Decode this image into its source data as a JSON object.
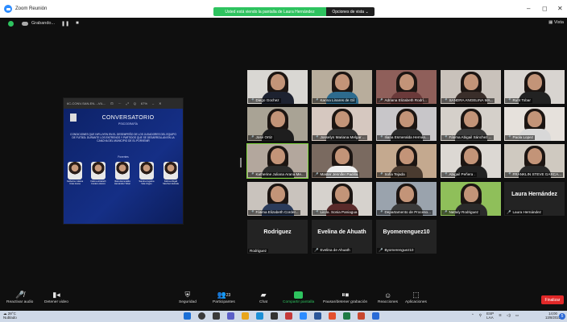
{
  "window": {
    "title": "Zoom Reunión",
    "minimize": "–",
    "maximize": "◻",
    "close": "✕"
  },
  "share_banner": {
    "text": "Usted está viendo la pantalla de Laura Hernández",
    "view_options": "Opciones de vista ⌄"
  },
  "topbar": {
    "recording_label": "Grabando...",
    "pause": "❚❚",
    "stop": "■",
    "view_label": "Vista"
  },
  "shared_screen": {
    "window_bar": [
      "6C-CONV-SAN-EN...-VIL...",
      "⊡",
      "···",
      "⤢",
      "Q",
      "67%",
      "–",
      "✕"
    ],
    "slide_title": "CONVERSATORIO",
    "slide_subtitle": "PSICOGRAFÍA",
    "slide_body": "CONDICIONES QUE INFLUYEN EN EL DESEMPEÑO DE LOS JUGADORES DEL EQUIPO DE FUTBOL DURANTE LOS ENTRENOS Y PARTIDOS QUE SE DESARROLLAN EN LA CANCHA DEL MUNICIPIO DE EL PORVENIR",
    "speakers_label": "Ponentes",
    "speakers": [
      "Katherine Juliana Urias Arana",
      "Fatima elizabeth Cordero Alonzo",
      "Iliana Esmeralda Hernández Tobar",
      "Sandra Angelina Vela Ungon",
      "Fátima Abigail Sánchez Estrada"
    ]
  },
  "participants": [
    {
      "name": "Diego Gochez",
      "video": true,
      "bg": "#d9d7d3",
      "shirt": "#1d2230"
    },
    {
      "name": "Karina Linares de Gil",
      "video": true,
      "bg": "#b8ad9c",
      "shirt": "#2d6b8e"
    },
    {
      "name": "Adriana Elizabeth Rodrí...",
      "video": true,
      "bg": "#8f5f5a",
      "shirt": "#6b3a3a"
    },
    {
      "name": "SANDRA ANGELINA MA...",
      "video": true,
      "bg": "#c9c2bb",
      "shirt": "#3a2e2a"
    },
    {
      "name": "Ruht Tobar",
      "video": true,
      "bg": "#d8d4d0",
      "shirt": "#222"
    },
    {
      "name": "José Ortiz",
      "video": true,
      "bg": "#a9a395",
      "shirt": "#1e1e1e"
    },
    {
      "name": "Josselyn Mariana Melgar ...",
      "video": true,
      "bg": "#d6c8c0",
      "shirt": "#333"
    },
    {
      "name": "Iliana Esmeralda Hernán...",
      "video": true,
      "bg": "#c8c6c9",
      "shirt": "#2c2c2c"
    },
    {
      "name": "Fátima Abigail Sánchez ...",
      "video": true,
      "bg": "#d5d0ca",
      "shirt": "#3b3b3b"
    },
    {
      "name": "Paola Lopez",
      "video": true,
      "bg": "#e6e1dc",
      "shirt": "#d8d8d8"
    },
    {
      "name": "Katherine Juliana Arana Me...",
      "video": true,
      "bg": "#b3a79d",
      "shirt": "#2b2b2b",
      "active": true
    },
    {
      "name": "Master Jennifer Padilla",
      "video": true,
      "bg": "#7a6a60",
      "shirt": "#efefef"
    },
    {
      "name": "Sofia Tejada",
      "video": true,
      "bg": "#c4a98f",
      "shirt": "#4a3b30"
    },
    {
      "name": "Abigail Peñera .",
      "video": true,
      "bg": "#dcd8d3",
      "shirt": "#222"
    },
    {
      "name": "FRANKLIN STEVE GARCA...",
      "video": true,
      "bg": "#cfc9c0",
      "shirt": "#2a2a2a"
    },
    {
      "name": "Fátima Elizabeth Corder...",
      "video": true,
      "bg": "#c9c3bd",
      "shirt": "#2b3b5a"
    },
    {
      "name": "Licda. Sonia Paniagua",
      "video": true,
      "bg": "#d6d2cd",
      "shirt": "#5a2a2a"
    },
    {
      "name": "Departamento de Proceso...",
      "video": true,
      "bg": "#9aa3ad",
      "shirt": "#3a3a3a"
    },
    {
      "name": "Nattaly Rodriguez",
      "video": true,
      "bg": "#8fbf5a",
      "shirt": "#2a2a2a"
    },
    {
      "name": "Laura Hernández",
      "video": false,
      "display": "Laura Hernández"
    },
    {
      "name": "Rodriguez",
      "video": false,
      "display": "Rodriguez"
    },
    {
      "name": "Evelina de Ahuath",
      "video": false,
      "display": "Evelina de Ahuath"
    },
    {
      "name": "Byomerenguez10",
      "video": false,
      "display": "Byomerenguez10"
    }
  ],
  "toolbar": {
    "audio": "Reactivar audio",
    "video": "Detener video",
    "security": "Seguridad",
    "participants": "Participantes",
    "participants_count": "23",
    "chat": "Chat",
    "share": "Compartir pantalla",
    "record": "Pausar/detener grabación",
    "reactions": "Reacciones",
    "apps": "Aplicaciones",
    "end": "Finalizar"
  },
  "taskbar": {
    "temp": "28°C",
    "weather": "Nublado",
    "lang": "ESP",
    "lang2": "LAA",
    "time": "14:00",
    "date": "13/8/2022",
    "notifications": "5"
  }
}
